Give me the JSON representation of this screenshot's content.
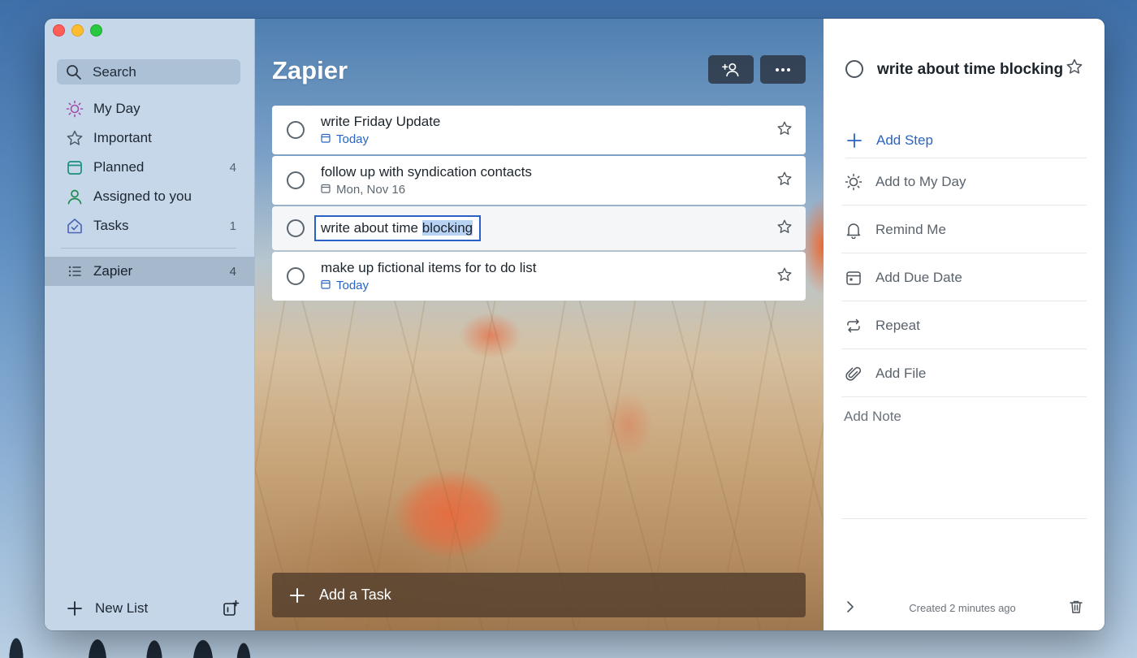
{
  "sidebar": {
    "search_label": "Search",
    "items": [
      {
        "label": "My Day",
        "count": "",
        "icon": "sun-icon"
      },
      {
        "label": "Important",
        "count": "",
        "icon": "star-icon"
      },
      {
        "label": "Planned",
        "count": "4",
        "icon": "calendar-icon"
      },
      {
        "label": "Assigned to you",
        "count": "",
        "icon": "person-icon"
      },
      {
        "label": "Tasks",
        "count": "1",
        "icon": "home-icon"
      }
    ],
    "lists": [
      {
        "label": "Zapier",
        "count": "4",
        "icon": "list-icon"
      }
    ],
    "new_list_label": "New List"
  },
  "main": {
    "title": "Zapier",
    "tasks": [
      {
        "title": "write Friday Update",
        "due": "Today",
        "due_style": "blue"
      },
      {
        "title": "follow up with syndication contacts",
        "due": "Mon, Nov 16",
        "due_style": "gray"
      },
      {
        "title_prefix": "write about time ",
        "title_selected": "blocking",
        "editing": true
      },
      {
        "title": "make up fictional items for to do list",
        "due": "Today",
        "due_style": "blue"
      }
    ],
    "add_task_label": "Add a Task"
  },
  "detail": {
    "title": "write about time blocking",
    "add_step_label": "Add Step",
    "rows": [
      {
        "label": "Add to My Day",
        "icon": "sun-icon"
      },
      {
        "label": "Remind Me",
        "icon": "bell-icon"
      },
      {
        "label": "Add Due Date",
        "icon": "calendar-icon"
      },
      {
        "label": "Repeat",
        "icon": "repeat-icon"
      },
      {
        "label": "Add File",
        "icon": "paperclip-icon"
      }
    ],
    "add_note_placeholder": "Add Note",
    "created_text": "Created 2 minutes ago"
  },
  "colors": {
    "accent_blue": "#2a64c4",
    "sidebar_bg": "#c6d7ea",
    "selected_list_bg": "#a5b8cc"
  }
}
